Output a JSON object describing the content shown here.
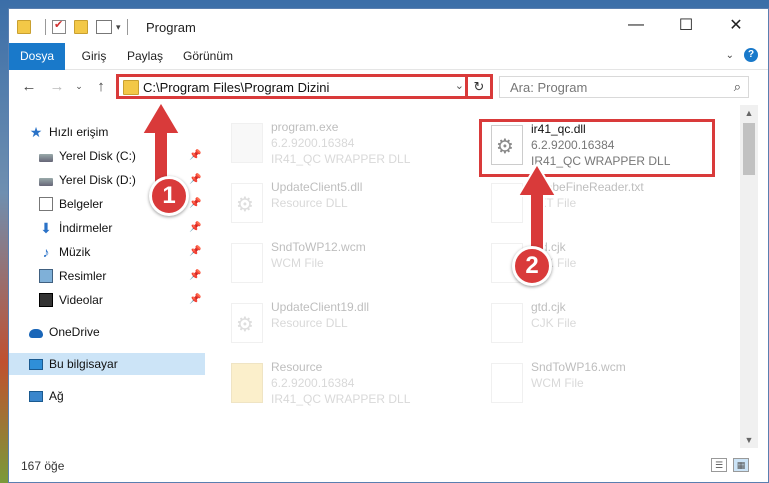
{
  "window": {
    "title": "Program"
  },
  "ribbon": {
    "tabs": [
      "Dosya",
      "Giriş",
      "Paylaş",
      "Görünüm"
    ]
  },
  "address": {
    "path": "C:\\Program Files\\Program Dizini"
  },
  "search": {
    "placeholder": "Ara: Program"
  },
  "nav": {
    "items": [
      {
        "label": "Hızlı erişim",
        "icon": "star-icon"
      },
      {
        "label": "Yerel Disk (C:)",
        "icon": "drive-icon",
        "pinned": true
      },
      {
        "label": "Yerel Disk (D:)",
        "icon": "drive-icon",
        "pinned": true
      },
      {
        "label": "Belgeler",
        "icon": "documents-icon",
        "pinned": true
      },
      {
        "label": "İndirmeler",
        "icon": "download-icon",
        "pinned": true
      },
      {
        "label": "Müzik",
        "icon": "music-icon",
        "pinned": true
      },
      {
        "label": "Resimler",
        "icon": "pictures-icon",
        "pinned": true
      },
      {
        "label": "Videolar",
        "icon": "videos-icon",
        "pinned": true
      },
      {
        "label": "OneDrive",
        "icon": "onedrive-icon"
      },
      {
        "label": "Bu bilgisayar",
        "icon": "computer-icon",
        "selected": true
      },
      {
        "label": "Ağ",
        "icon": "network-icon"
      }
    ]
  },
  "files": [
    {
      "name": "program.exe",
      "l2": "6.2.9200.16384",
      "l3": "IR41_QC WRAPPER DLL",
      "icon": "exe-icon"
    },
    {
      "name": "ir41_qc.dll",
      "l2": "6.2.9200.16384",
      "l3": "IR41_QC WRAPPER DLL",
      "icon": "dll-gear-icon",
      "highlighted": true
    },
    {
      "name": "UpdateClient5.dll",
      "l2": "Resource DLL",
      "l3": "",
      "icon": "dll-gear-icon"
    },
    {
      "name": "AdobeFineReader.txt",
      "l2": "TXT File",
      "l3": "",
      "icon": "text-file-icon"
    },
    {
      "name": "SndToWP12.wcm",
      "l2": "WCM File",
      "l3": "",
      "icon": "file-icon"
    },
    {
      "name": "gtd.cjk",
      "l2": "CJK File",
      "l3": "",
      "icon": "file-icon"
    },
    {
      "name": "UpdateClient19.dll",
      "l2": "Resource DLL",
      "l3": "",
      "icon": "dll-gear-icon"
    },
    {
      "name": "gtd.cjk",
      "l2": "CJK File",
      "l3": "",
      "icon": "file-icon"
    },
    {
      "name": "Resource",
      "l2": "6.2.9200.16384",
      "l3": "IR41_QC WRAPPER DLL",
      "icon": "folder-icon"
    },
    {
      "name": "SndToWP16.wcm",
      "l2": "WCM File",
      "l3": "",
      "icon": "file-icon"
    }
  ],
  "status": {
    "count": "167 öğe"
  },
  "annotations": {
    "badge1": "1",
    "badge2": "2"
  },
  "colors": {
    "accent": "#1979ca",
    "highlight": "#d93a3a",
    "selection": "#cce4f7"
  }
}
